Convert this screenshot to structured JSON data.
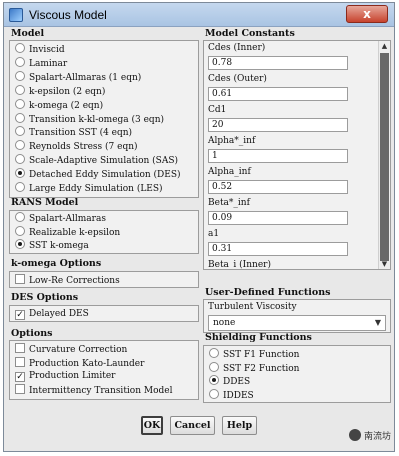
{
  "window": {
    "title": "Viscous Model",
    "close_label": "x"
  },
  "model": {
    "title": "Model",
    "options": [
      {
        "label": "Inviscid",
        "selected": false
      },
      {
        "label": "Laminar",
        "selected": false
      },
      {
        "label": "Spalart-Allmaras (1 eqn)",
        "selected": false
      },
      {
        "label": "k-epsilon (2 eqn)",
        "selected": false
      },
      {
        "label": "k-omega (2 eqn)",
        "selected": false
      },
      {
        "label": "Transition k-kl-omega (3 eqn)",
        "selected": false
      },
      {
        "label": "Transition SST (4 eqn)",
        "selected": false
      },
      {
        "label": "Reynolds Stress (7 eqn)",
        "selected": false
      },
      {
        "label": "Scale-Adaptive Simulation (SAS)",
        "selected": false
      },
      {
        "label": "Detached Eddy Simulation (DES)",
        "selected": true
      },
      {
        "label": "Large Eddy Simulation (LES)",
        "selected": false
      }
    ]
  },
  "rans": {
    "title": "RANS Model",
    "options": [
      {
        "label": "Spalart-Allmaras",
        "selected": false
      },
      {
        "label": "Realizable k-epsilon",
        "selected": false
      },
      {
        "label": "SST k-omega",
        "selected": true
      }
    ]
  },
  "komega": {
    "title": "k-omega Options",
    "options": [
      {
        "label": "Low-Re Corrections",
        "checked": false
      }
    ]
  },
  "des": {
    "title": "DES Options",
    "options": [
      {
        "label": "Delayed DES",
        "checked": true
      }
    ]
  },
  "options": {
    "title": "Options",
    "items": [
      {
        "label": "Curvature Correction",
        "checked": false
      },
      {
        "label": "Production Kato-Launder",
        "checked": false
      },
      {
        "label": "Production Limiter",
        "checked": true
      },
      {
        "label": "Intermittency Transition Model",
        "checked": false
      }
    ]
  },
  "constants": {
    "title": "Model Constants",
    "items": [
      {
        "label": "Cdes (Inner)",
        "value": "0.78"
      },
      {
        "label": "Cdes (Outer)",
        "value": "0.61"
      },
      {
        "label": "Cd1",
        "value": "20"
      },
      {
        "label": "Alpha*_inf",
        "value": "1"
      },
      {
        "label": "Alpha_inf",
        "value": "0.52"
      },
      {
        "label": "Beta*_inf",
        "value": "0.09"
      },
      {
        "label": "a1",
        "value": "0.31"
      },
      {
        "label": "Beta_i (Inner)",
        "value": ""
      }
    ]
  },
  "udf": {
    "title": "User-Defined Functions",
    "label": "Turbulent Viscosity",
    "value": "none"
  },
  "shielding": {
    "title": "Shielding Functions",
    "options": [
      {
        "label": "SST F1 Function",
        "selected": false
      },
      {
        "label": "SST F2 Function",
        "selected": false
      },
      {
        "label": "DDES",
        "selected": true
      },
      {
        "label": "IDDES",
        "selected": false
      }
    ]
  },
  "buttons": {
    "ok": "OK",
    "cancel": "Cancel",
    "help": "Help"
  },
  "watermark": "南流坊"
}
